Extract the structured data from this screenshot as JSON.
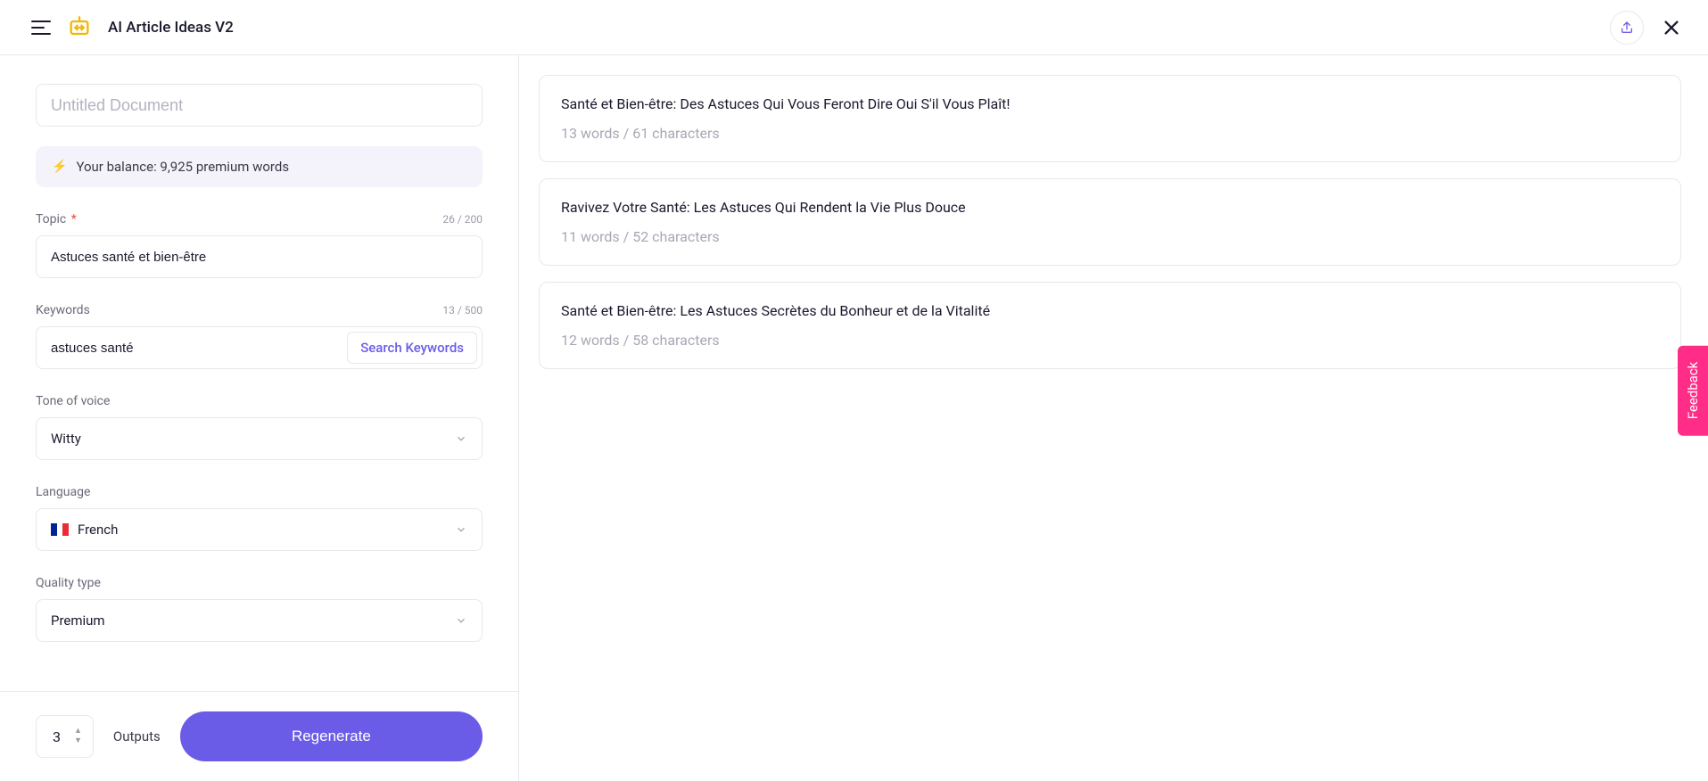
{
  "header": {
    "title": "AI Article Ideas V2"
  },
  "sidebar": {
    "title_placeholder": "Untitled Document",
    "balance": "Your balance: 9,925 premium words",
    "topic": {
      "label": "Topic",
      "counter": "26 / 200",
      "value": "Astuces santé et bien-être"
    },
    "keywords": {
      "label": "Keywords",
      "counter": "13 / 500",
      "value": "astuces santé",
      "search_label": "Search Keywords"
    },
    "tone": {
      "label": "Tone of voice",
      "value": "Witty"
    },
    "language": {
      "label": "Language",
      "value": "French"
    },
    "quality": {
      "label": "Quality type",
      "value": "Premium"
    }
  },
  "footer": {
    "count": "3",
    "outputs_label": "Outputs",
    "regenerate": "Regenerate"
  },
  "results": [
    {
      "title": "Santé et Bien-être: Des Astuces Qui Vous Feront Dire Oui S'il Vous Plaît!",
      "meta": "13 words / 61 characters"
    },
    {
      "title": "Ravivez Votre Santé: Les Astuces Qui Rendent la Vie Plus Douce",
      "meta": "11 words / 52 characters"
    },
    {
      "title": "Santé et Bien-être: Les Astuces Secrètes du Bonheur et de la Vitalité",
      "meta": "12 words / 58 characters"
    }
  ],
  "feedback": "Feedback"
}
